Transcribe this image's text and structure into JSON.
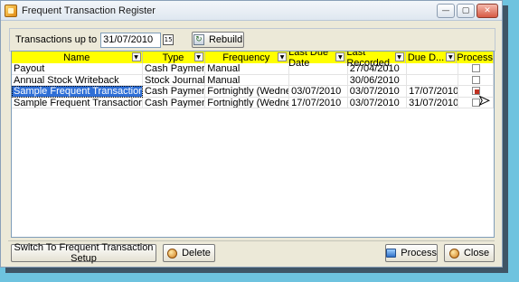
{
  "window": {
    "title": "Frequent Transaction Register",
    "controls": {
      "minimize": "—",
      "maximize": "▢",
      "close": "✕"
    }
  },
  "toolbar": {
    "label": "Transactions up to",
    "date_value": "31/07/2010",
    "calendar_glyph": "15",
    "rebuild_label": "Rebuild"
  },
  "grid": {
    "columns": [
      {
        "label": "Name",
        "width": 153
      },
      {
        "label": "Type",
        "width": 73
      },
      {
        "label": "Frequency",
        "width": 98
      },
      {
        "label": "Last Due Date",
        "width": 68
      },
      {
        "label": "Last Recorded",
        "width": 69
      },
      {
        "label": "Due D...",
        "width": 60,
        "sort": "↗"
      },
      {
        "label": "Process",
        "width": 41
      }
    ],
    "rows": [
      {
        "name": "Payout",
        "type": "Cash Payment",
        "frequency": "Manual",
        "last_due": "",
        "last_recorded": "27/04/2010",
        "due": "",
        "process": false,
        "selected": false
      },
      {
        "name": "Annual Stock Writeback",
        "type": "Stock Journal",
        "frequency": "Manual",
        "last_due": "",
        "last_recorded": "30/06/2010",
        "due": "",
        "process": false,
        "selected": false
      },
      {
        "name": "Sample Frequent Transaction",
        "type": "Cash Payment",
        "frequency": "Fortnightly (Wednesday)",
        "last_due": "03/07/2010",
        "last_recorded": "03/07/2010",
        "due": "17/07/2010",
        "process": true,
        "selected": true
      },
      {
        "name": "Sample Frequent Transaction",
        "type": "Cash Payment",
        "frequency": "Fortnightly (Wednesday)",
        "last_due": "17/07/2010",
        "last_recorded": "03/07/2010",
        "due": "31/07/2010",
        "process": false,
        "selected": false
      }
    ]
  },
  "footer": {
    "setup_label": "Switch To Frequent Transaction Setup",
    "delete_label": "Delete",
    "process_label": "Process",
    "close_label": "Close"
  },
  "colors": {
    "header_bg": "#ffff00",
    "selection": "#2f6fd6",
    "desktop": "#6ec3df"
  }
}
